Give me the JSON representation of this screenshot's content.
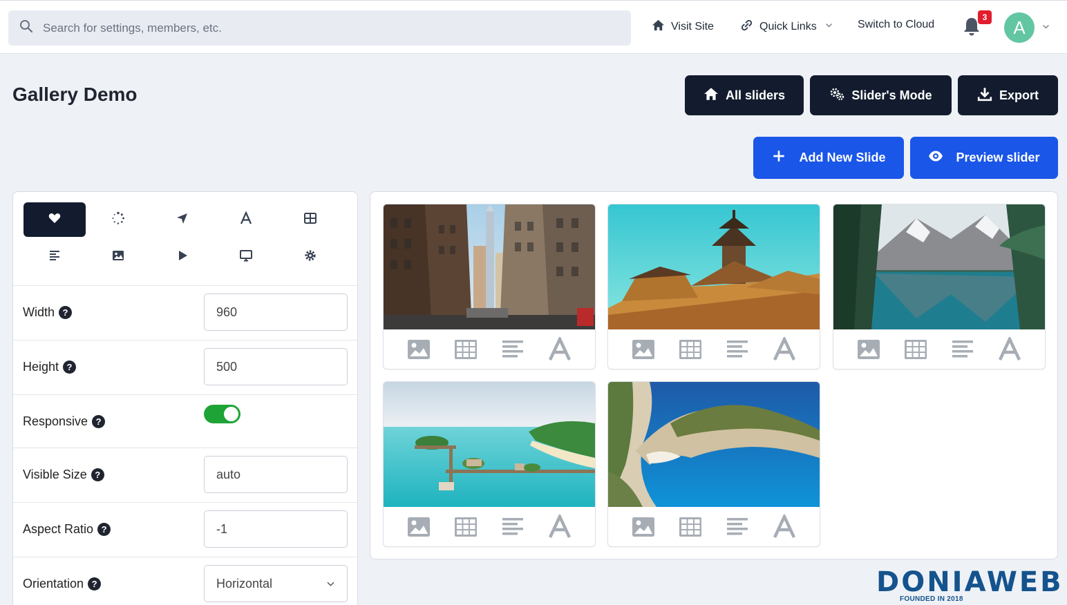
{
  "topbar": {
    "search_placeholder": "Search for settings, members, etc.",
    "visit_site": "Visit Site",
    "quick_links": "Quick Links",
    "switch_cloud": "Switch to Cloud",
    "notification_count": "3",
    "avatar_letter": "A"
  },
  "page": {
    "title": "Gallery Demo",
    "all_sliders": "All sliders",
    "sliders_mode": "Slider's Mode",
    "export": "Export",
    "add_new_slide": "Add New Slide",
    "preview_slider": "Preview slider"
  },
  "settings": {
    "tabs": [
      "heart-icon",
      "spinner-icon",
      "navigation-arrow-icon",
      "font-icon",
      "table-icon",
      "align-left-icon",
      "image-icon",
      "play-icon",
      "desktop-icon",
      "gear-icon"
    ],
    "active_tab": 0,
    "rows": [
      {
        "label": "Width",
        "value": "960"
      },
      {
        "label": "Height",
        "value": "500"
      },
      {
        "label": "Responsive",
        "value": "on"
      },
      {
        "label": "Visible Size",
        "value": "auto"
      },
      {
        "label": "Aspect Ratio",
        "value": "-1"
      },
      {
        "label": "Orientation",
        "value": "Horizontal"
      }
    ],
    "help_glyph": "?"
  },
  "slides": [
    {
      "scene": "city-street"
    },
    {
      "scene": "temple-roof"
    },
    {
      "scene": "mountain-lake"
    },
    {
      "scene": "tropical-island"
    },
    {
      "scene": "cove-beach"
    }
  ],
  "slide_tools": [
    "image-icon",
    "table-icon",
    "align-left-icon",
    "font-icon"
  ],
  "colors": {
    "dark_button": "#131c2e",
    "primary_button": "#1a56e8",
    "toggle_on": "#1ea436",
    "badge": "#e11d2e",
    "avatar": "#62c6a2"
  },
  "watermark": {
    "brand": "DONIAWEB",
    "tagline": "FOUNDED IN 2018"
  }
}
